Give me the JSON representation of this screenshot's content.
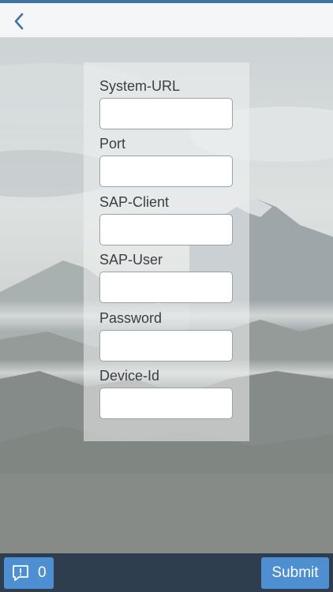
{
  "header": {
    "back_icon": "chevron-left-icon"
  },
  "form": {
    "fields": [
      {
        "label": "System-URL",
        "value": "",
        "placeholder": ""
      },
      {
        "label": "Port",
        "value": "",
        "placeholder": ""
      },
      {
        "label": "SAP-Client",
        "value": "",
        "placeholder": ""
      },
      {
        "label": "SAP-User",
        "value": "",
        "placeholder": ""
      },
      {
        "label": "Password",
        "value": "",
        "placeholder": ""
      },
      {
        "label": "Device-Id",
        "value": "",
        "placeholder": ""
      }
    ]
  },
  "footer": {
    "messages_icon": "message-alert-icon",
    "messages_count": "0",
    "submit_label": "Submit"
  },
  "colors": {
    "accent": "#3f73a6",
    "button": "#4d8fd0",
    "footer_bg": "#2f3e4e"
  }
}
